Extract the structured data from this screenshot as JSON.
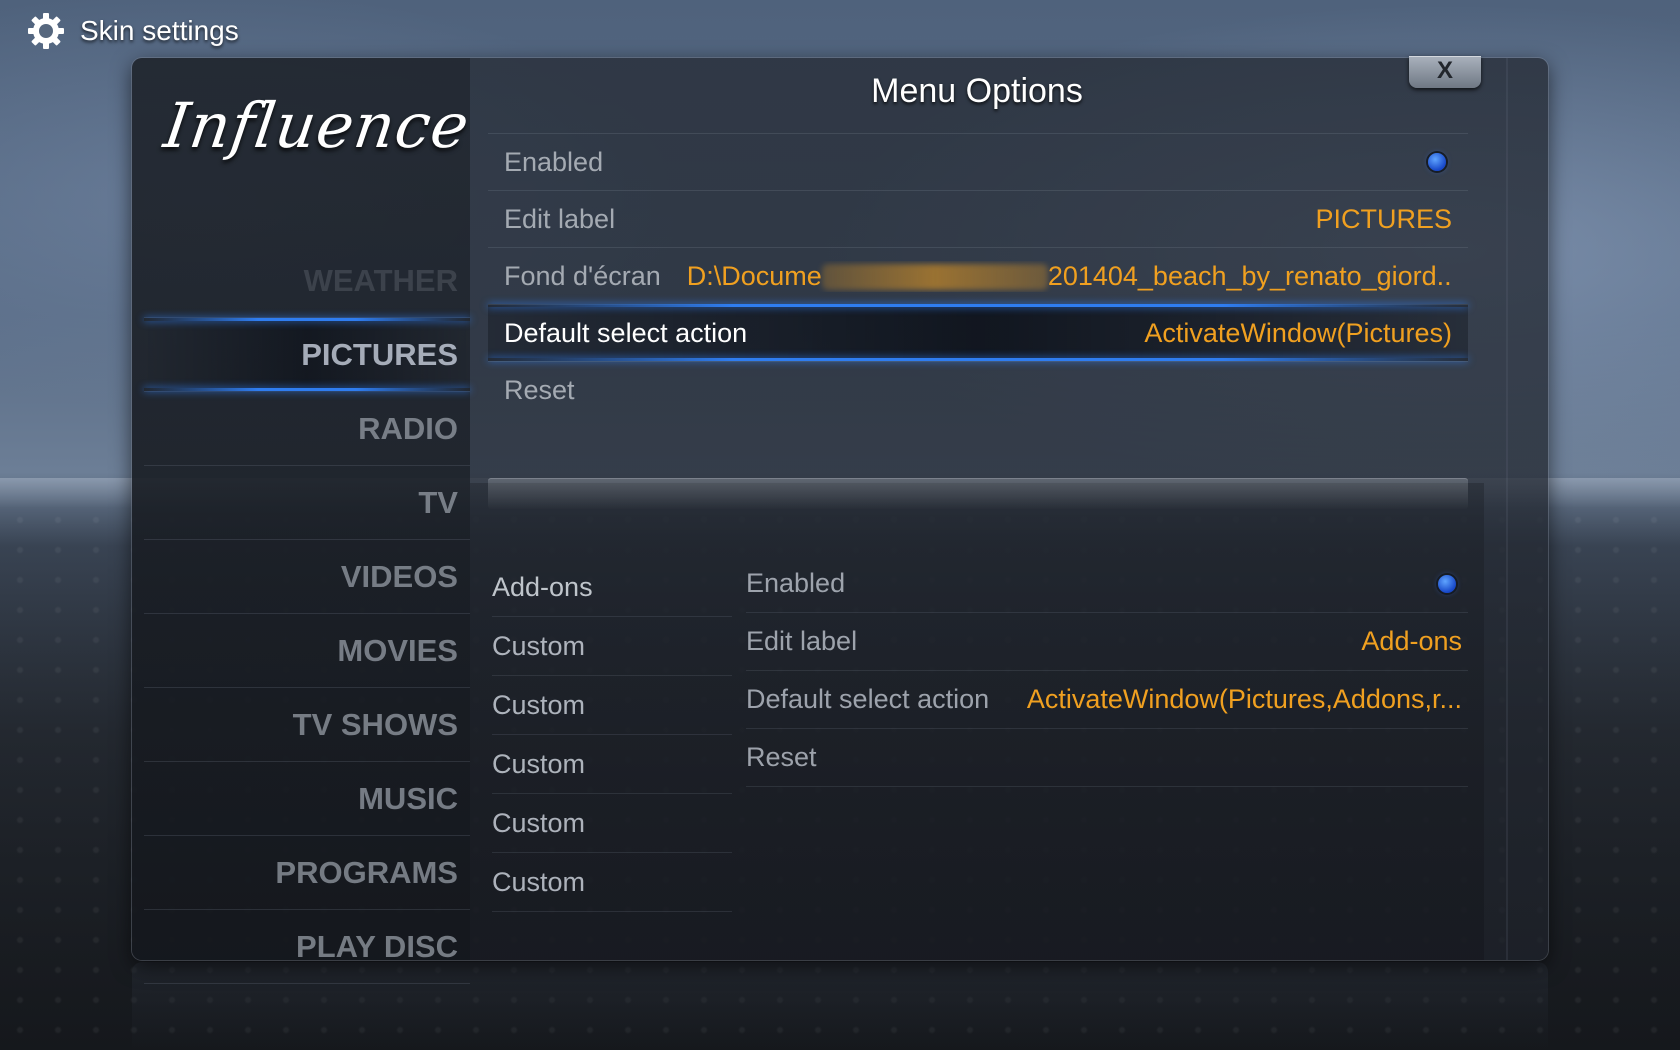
{
  "header": {
    "title": "Skin settings"
  },
  "logo": {
    "text": "Influence"
  },
  "dialog": {
    "title": "Menu Options",
    "close_label": "X"
  },
  "nav": {
    "items": [
      {
        "label": "WEATHER"
      },
      {
        "label": "PICTURES"
      },
      {
        "label": "RADIO"
      },
      {
        "label": "TV"
      },
      {
        "label": "VIDEOS"
      },
      {
        "label": "MOVIES"
      },
      {
        "label": "TV SHOWS"
      },
      {
        "label": "MUSIC"
      },
      {
        "label": "PROGRAMS"
      },
      {
        "label": "PLAY DISC"
      }
    ],
    "active_index": 1
  },
  "options": {
    "enabled": {
      "label": "Enabled",
      "state": "on"
    },
    "edit_label": {
      "label": "Edit label",
      "value": "PICTURES"
    },
    "background": {
      "label": "Fond d'écran",
      "value_start": "D:\\Docume",
      "value_end": "201404_beach_by_renato_giord..."
    },
    "default_action": {
      "label": "Default select action",
      "value": "ActivateWindow(Pictures)"
    },
    "reset": {
      "label": "Reset"
    }
  },
  "submenu": {
    "items": [
      {
        "label": "Add-ons"
      },
      {
        "label": "Custom"
      },
      {
        "label": "Custom"
      },
      {
        "label": "Custom"
      },
      {
        "label": "Custom"
      },
      {
        "label": "Custom"
      }
    ],
    "options": {
      "enabled": {
        "label": "Enabled",
        "state": "on"
      },
      "edit_label": {
        "label": "Edit label",
        "value": "Add-ons"
      },
      "default_action": {
        "label": "Default select action",
        "value": "ActivateWindow(Pictures,Addons,r..."
      },
      "reset": {
        "label": "Reset"
      }
    }
  },
  "colors": {
    "accent_blue": "#2f7df0",
    "value_orange": "#f0a020"
  }
}
